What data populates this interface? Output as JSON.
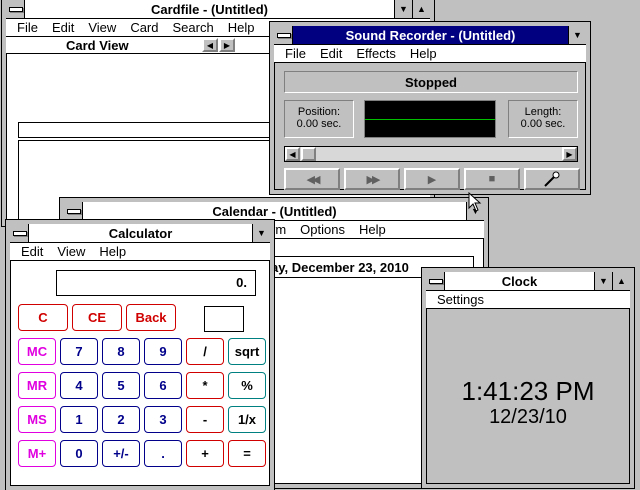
{
  "cardfile": {
    "title": "Cardfile - (Untitled)",
    "menu": [
      "File",
      "Edit",
      "View",
      "Card",
      "Search",
      "Help"
    ],
    "view_label": "Card View",
    "nav_prev_icon": "left-arrow-icon",
    "nav_next_icon": "right-arrow-icon"
  },
  "sound_recorder": {
    "title": "Sound Recorder - (Untitled)",
    "menu": [
      "File",
      "Edit",
      "Effects",
      "Help"
    ],
    "status": "Stopped",
    "position_label": "Position:",
    "position_value": "0.00 sec.",
    "length_label": "Length:",
    "length_value": "0.00 sec.",
    "buttons": [
      "rewind-icon",
      "fast-forward-icon",
      "play-icon",
      "stop-icon",
      "record-icon"
    ],
    "colors": {
      "wave_bg": "#000000",
      "wave_line": "#00c000"
    }
  },
  "calendar": {
    "title": "Calendar - (Untitled)",
    "menu_visible": [
      "rm",
      "Options",
      "Help"
    ],
    "date_text": "ay, December 23, 2010"
  },
  "calculator": {
    "title": "Calculator",
    "menu": [
      "Edit",
      "View",
      "Help"
    ],
    "display": "0.",
    "row0": [
      "C",
      "CE",
      "Back"
    ],
    "rows": [
      [
        "MC",
        "7",
        "8",
        "9",
        "/",
        "sqrt"
      ],
      [
        "MR",
        "4",
        "5",
        "6",
        "*",
        "%"
      ],
      [
        "MS",
        "1",
        "2",
        "3",
        "-",
        "1/x"
      ],
      [
        "M+",
        "0",
        "+/-",
        ".",
        "+",
        "="
      ]
    ]
  },
  "clock": {
    "title": "Clock",
    "menu": [
      "Settings"
    ],
    "time": "1:41:23 PM",
    "date": "12/23/10"
  }
}
